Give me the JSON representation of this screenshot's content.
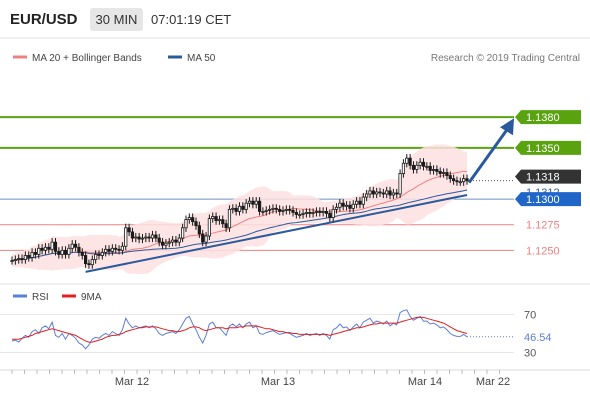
{
  "header": {
    "pair": "EUR/USD",
    "timeframe": "30 MIN",
    "time": "07:01:19 CET"
  },
  "legend": {
    "ma20": "MA 20 + Bollinger Bands",
    "ma50": "MA 50",
    "source": "Research © 2019 Trading Central"
  },
  "colors": {
    "resistance": "#59a310",
    "support": "#f08080",
    "trend": "#2a5a9c",
    "ma50": "#2a5a9c",
    "ma20": "#f08080",
    "band": "#fde0e0",
    "last": "#333333",
    "rsi": "#5b7fd6",
    "rsi_ma": "#e02020",
    "up": "#1a1a1a",
    "down": "#1a1a1a"
  },
  "chart_data": [
    {
      "type": "candlestick",
      "title": "EUR/USD",
      "ylim": [
        1.1223,
        1.1428
      ],
      "x_ticks": [
        "Mar 12",
        "Mar 13",
        "Mar 14",
        "Mar 22"
      ],
      "levels": [
        {
          "value": 1.138,
          "label": "1.1380",
          "kind": "resistance"
        },
        {
          "value": 1.135,
          "label": "1.1350",
          "kind": "resistance"
        },
        {
          "value": 1.1318,
          "label": "1.1318",
          "kind": "last"
        },
        {
          "value": 1.1312,
          "label": "1.1312",
          "kind": "ma50"
        },
        {
          "value": 1.13,
          "label": "1.1300",
          "kind": "pivot"
        },
        {
          "value": 1.1275,
          "label": "1.1275",
          "kind": "support"
        },
        {
          "value": 1.125,
          "label": "1.1250",
          "kind": "support"
        }
      ],
      "close": [
        1.124,
        1.1241,
        1.1242,
        1.1241,
        1.1245,
        1.1243,
        1.1248,
        1.1246,
        1.1252,
        1.125,
        1.1253,
        1.1251,
        1.1258,
        1.1249,
        1.1246,
        1.125,
        1.1246,
        1.1252,
        1.1256,
        1.1253,
        1.1248,
        1.1245,
        1.1237,
        1.1236,
        1.1241,
        1.1246,
        1.1245,
        1.1248,
        1.1251,
        1.1249,
        1.1252,
        1.1251,
        1.125,
        1.1254,
        1.1272,
        1.1268,
        1.1262,
        1.1263,
        1.1261,
        1.1262,
        1.1263,
        1.1262,
        1.1265,
        1.1262,
        1.1258,
        1.1255,
        1.1257,
        1.1258,
        1.126,
        1.1258,
        1.1262,
        1.1272,
        1.128,
        1.1282,
        1.1278,
        1.1274,
        1.1266,
        1.1258,
        1.1264,
        1.1281,
        1.1283,
        1.1279,
        1.128,
        1.1276,
        1.1272,
        1.129,
        1.1291,
        1.1288,
        1.1293,
        1.129,
        1.1296,
        1.1298,
        1.1295,
        1.1298,
        1.1288,
        1.1288,
        1.1289,
        1.129,
        1.1291,
        1.129,
        1.1288,
        1.1289,
        1.129,
        1.1289,
        1.1287,
        1.1285,
        1.1285,
        1.1286,
        1.1287,
        1.1286,
        1.1287,
        1.1288,
        1.1287,
        1.1288,
        1.1286,
        1.1282,
        1.129,
        1.1292,
        1.1296,
        1.1293,
        1.1294,
        1.1291,
        1.1295,
        1.1298,
        1.1295,
        1.1302,
        1.1305,
        1.1308,
        1.1305,
        1.1307,
        1.1306,
        1.1305,
        1.1308,
        1.1304,
        1.1306,
        1.1305,
        1.1325,
        1.1335,
        1.134,
        1.1333,
        1.1329,
        1.1333,
        1.1336,
        1.1332,
        1.1332,
        1.1328,
        1.1329,
        1.1327,
        1.1325,
        1.1326,
        1.1323,
        1.132,
        1.1318,
        1.1317,
        1.1317,
        1.132,
        1.1318
      ]
    },
    {
      "type": "line",
      "title": "RSI",
      "ylim": [
        20,
        80
      ],
      "y_ticks": [
        70,
        30
      ],
      "last_label": "46.54",
      "series": [
        {
          "name": "RSI",
          "values": [
            42,
            43,
            41,
            45,
            48,
            46,
            52,
            54,
            50,
            56,
            58,
            55,
            62,
            48,
            46,
            50,
            44,
            50,
            48,
            45,
            40,
            38,
            34,
            38,
            44,
            46,
            45,
            48,
            50,
            48,
            52,
            50,
            48,
            54,
            66,
            60,
            56,
            58,
            56,
            57,
            58,
            56,
            58,
            55,
            50,
            48,
            50,
            51,
            52,
            50,
            54,
            60,
            66,
            68,
            60,
            54,
            46,
            40,
            48,
            60,
            62,
            56,
            56,
            52,
            48,
            58,
            60,
            57,
            60,
            56,
            60,
            62,
            56,
            58,
            50,
            49,
            51,
            52,
            53,
            51,
            49,
            50,
            51,
            50,
            48,
            46,
            47,
            48,
            50,
            48,
            49,
            50,
            48,
            50,
            48,
            44,
            54,
            56,
            60,
            56,
            57,
            53,
            57,
            60,
            56,
            62,
            64,
            66,
            61,
            63,
            62,
            60,
            63,
            58,
            61,
            59,
            72,
            74,
            75,
            68,
            64,
            66,
            68,
            63,
            63,
            60,
            61,
            59,
            56,
            57,
            54,
            50,
            48,
            47,
            47,
            49,
            46.54
          ]
        },
        {
          "name": "9MA",
          "values": [
            44,
            44,
            44,
            45,
            46,
            47,
            48,
            50,
            51,
            52,
            53,
            54,
            55,
            54,
            53,
            52,
            51,
            50,
            49,
            48,
            46,
            44,
            42,
            41,
            41,
            42,
            43,
            44,
            46,
            47,
            48,
            48,
            49,
            50,
            52,
            53,
            54,
            55,
            56,
            56,
            57,
            57,
            57,
            57,
            56,
            55,
            54,
            53,
            53,
            52,
            52,
            53,
            54,
            56,
            57,
            57,
            56,
            54,
            53,
            54,
            55,
            56,
            56,
            56,
            55,
            56,
            56,
            56,
            57,
            57,
            58,
            58,
            58,
            58,
            57,
            56,
            55,
            55,
            54,
            53,
            52,
            52,
            51,
            51,
            50,
            50,
            49,
            49,
            49,
            49,
            49,
            49,
            49,
            49,
            49,
            48,
            49,
            50,
            51,
            52,
            53,
            54,
            55,
            56,
            56,
            57,
            58,
            59,
            60,
            60,
            61,
            61,
            61,
            61,
            61,
            61,
            62,
            63,
            64,
            65,
            66,
            67,
            67,
            67,
            66,
            65,
            64,
            63,
            62,
            61,
            59,
            57,
            55,
            53,
            52,
            51,
            50
          ]
        }
      ]
    }
  ]
}
